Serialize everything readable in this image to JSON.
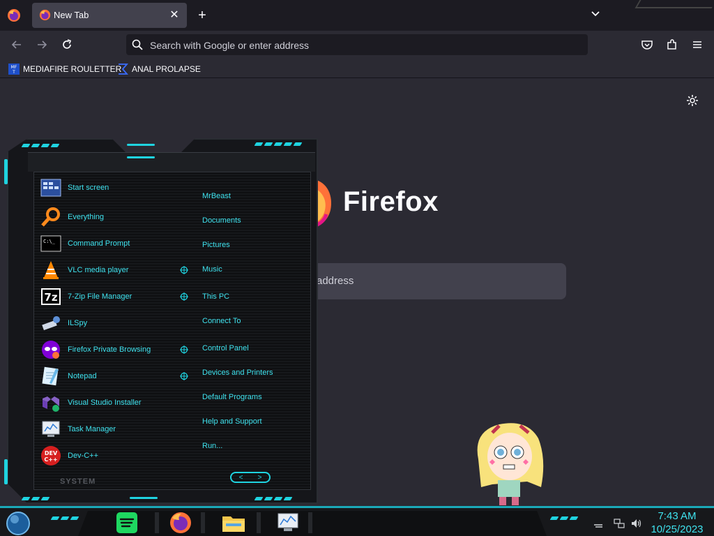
{
  "tabs": [
    {
      "label": "New Tab",
      "close_glyph": "✕"
    }
  ],
  "new_tab_glyph": "+",
  "address_bar": {
    "placeholder": "Search with Google or enter address"
  },
  "bookmarks": [
    {
      "label": "MEDIAFIRE ROULETTER",
      "icon": "mediafire-icon"
    },
    {
      "label": "ANAL PROLAPSE",
      "icon": "bookmark-sigma-icon"
    }
  ],
  "newtab_page": {
    "brand": "Firefox",
    "search_text": "address"
  },
  "start_menu": {
    "programs": [
      {
        "label": "Start screen",
        "icon": "start-screen-icon"
      },
      {
        "label": "Everything",
        "icon": "everything-search-icon"
      },
      {
        "label": "Command Prompt",
        "icon": "command-prompt-icon"
      },
      {
        "label": "VLC media player",
        "icon": "vlc-icon"
      },
      {
        "label": "7-Zip File Manager",
        "icon": "7zip-icon"
      },
      {
        "label": "ILSpy",
        "icon": "ilspy-icon"
      },
      {
        "label": "Firefox Private Browsing",
        "icon": "private-browsing-icon"
      },
      {
        "label": "Notepad",
        "icon": "notepad-icon"
      },
      {
        "label": "Visual Studio Installer",
        "icon": "visual-studio-installer-icon"
      },
      {
        "label": "Task Manager",
        "icon": "task-manager-icon"
      },
      {
        "label": "Dev-C++",
        "icon": "devcpp-icon"
      }
    ],
    "places": [
      {
        "label": "MrBeast"
      },
      {
        "label": "Documents"
      },
      {
        "label": "Pictures"
      },
      {
        "label": "Music"
      },
      {
        "label": "This PC"
      },
      {
        "label": "Connect To"
      },
      {
        "label": "Control Panel"
      },
      {
        "label": "Devices and Printers"
      },
      {
        "label": "Default Programs"
      },
      {
        "label": "Help and Support"
      },
      {
        "label": "Run..."
      }
    ],
    "system_label": "SYSTEM",
    "arrows": {
      "left": "<",
      "right": ">"
    },
    "seven_zip_text": "7z",
    "devcpp_text": "DEV C++",
    "mft_text": "MF T"
  },
  "taskbar": {
    "apps": [
      {
        "name": "spotify-app",
        "icon": "spotify-icon"
      },
      {
        "name": "firefox-app",
        "icon": "firefox-icon"
      },
      {
        "name": "file-explorer-app",
        "icon": "folder-icon"
      },
      {
        "name": "task-manager-app",
        "icon": "task-manager-icon"
      }
    ],
    "clock": {
      "time": "7:43 AM",
      "date": "10/25/2023"
    }
  },
  "colors": {
    "accent": "#1fd3e0",
    "menu_text": "#3fe2ee",
    "browser_bg": "#2b2a33",
    "taskbar_accent": "#1aa9b8"
  }
}
